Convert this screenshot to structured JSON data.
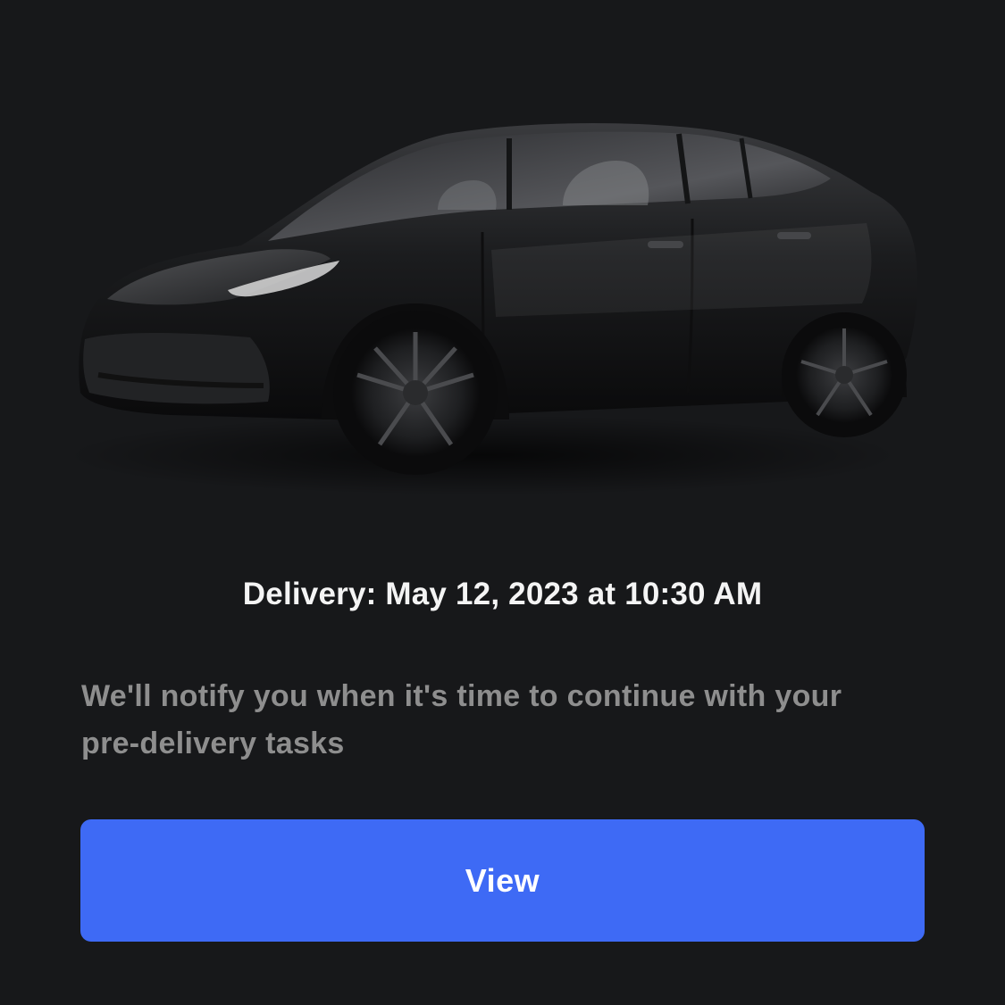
{
  "delivery": {
    "title": "Delivery: May 12, 2023 at 10:30 AM",
    "message": "We'll notify you when it's time to continue with your pre-delivery tasks"
  },
  "actions": {
    "view_label": "View"
  },
  "colors": {
    "background": "#17181a",
    "accent": "#3e6af5",
    "title_text": "#f4f4f4",
    "body_text": "#8e8e8e"
  },
  "vehicle": {
    "icon": "car-image",
    "color": "black"
  }
}
